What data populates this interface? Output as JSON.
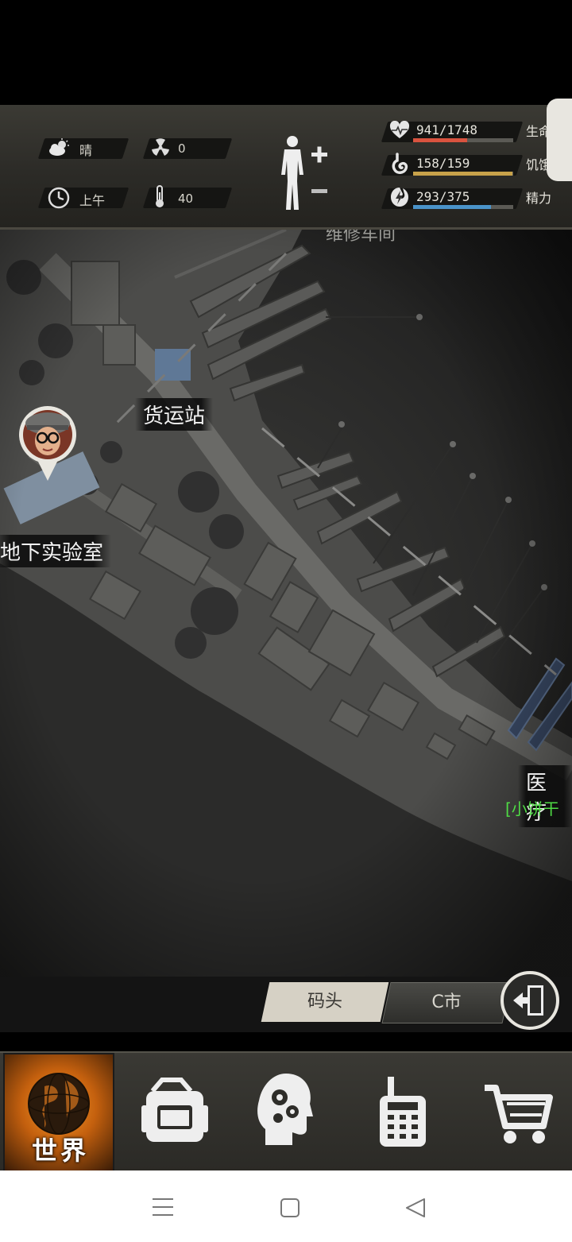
{
  "hud": {
    "weather": {
      "icon": "cloud-sun-icon",
      "text": "晴"
    },
    "radiation": {
      "icon": "radiation-icon",
      "value": "0"
    },
    "time": {
      "icon": "clock-icon",
      "text": "上午"
    },
    "temperature": {
      "icon": "thermometer-icon",
      "value": "40"
    },
    "stats": [
      {
        "icon": "heart-icon",
        "value": "941/1748",
        "label": "生命",
        "fraction": 0.538,
        "color": "#d9533f"
      },
      {
        "icon": "stomach-icon",
        "value": "158/159",
        "label": "饥饿",
        "fraction": 0.994,
        "color": "#c8a24a"
      },
      {
        "icon": "energy-icon",
        "value": "293/375",
        "label": "精力",
        "fraction": 0.781,
        "color": "#4a93c9"
      }
    ]
  },
  "map": {
    "top_partial_label": "维修车间",
    "locations": [
      {
        "name": "货运站"
      },
      {
        "name": "地下实验室"
      },
      {
        "name": "医疗"
      }
    ],
    "medical_sub": "[小饼干"
  },
  "tabs": {
    "dock": "码头",
    "city": "C市"
  },
  "nav": {
    "world": "世界"
  }
}
